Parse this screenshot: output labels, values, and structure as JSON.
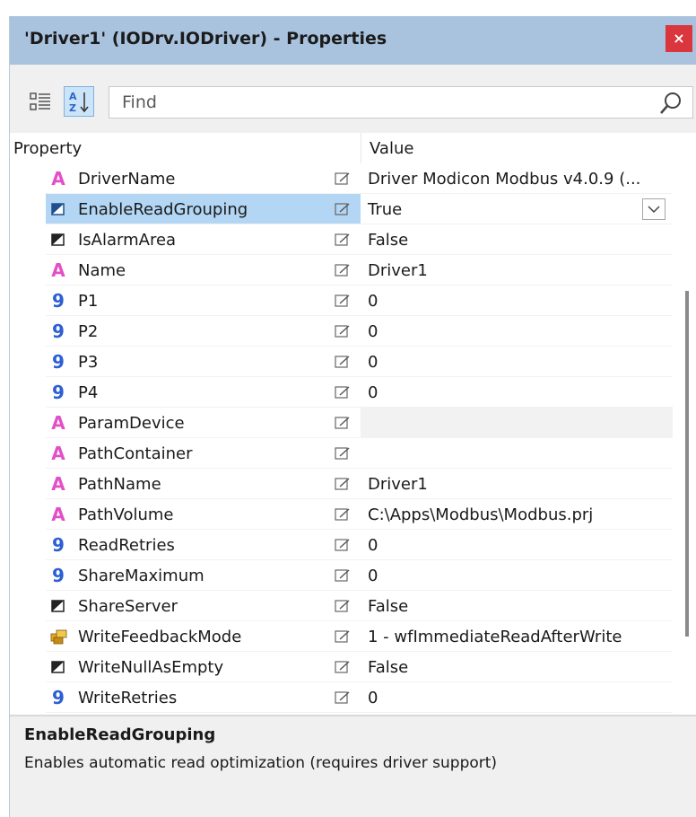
{
  "window": {
    "title": "'Driver1' (IODrv.IODriver) - Properties",
    "close_glyph": "×"
  },
  "toolbar": {
    "categorized_icon": "categorized-view-icon",
    "alphabetical_icon": "sort-alphabetical-icon",
    "find_placeholder": "Find",
    "search_icon": "magnifier-icon"
  },
  "grid": {
    "header_property": "Property",
    "header_value": "Value",
    "rows": [
      {
        "name": "DriverName",
        "type": "text",
        "value": "Driver Modicon Modbus v4.0.9 (..."
      },
      {
        "name": "EnableReadGrouping",
        "type": "bool",
        "value": "True",
        "selected": true,
        "has_dropdown": true
      },
      {
        "name": "IsAlarmArea",
        "type": "bool",
        "value": "False"
      },
      {
        "name": "Name",
        "type": "text",
        "value": "Driver1"
      },
      {
        "name": "P1",
        "type": "number",
        "value": "0"
      },
      {
        "name": "P2",
        "type": "number",
        "value": "0"
      },
      {
        "name": "P3",
        "type": "number",
        "value": "0"
      },
      {
        "name": "P4",
        "type": "number",
        "value": "0"
      },
      {
        "name": "ParamDevice",
        "type": "text",
        "value": "",
        "shaded": true
      },
      {
        "name": "PathContainer",
        "type": "text",
        "value": ""
      },
      {
        "name": "PathName",
        "type": "text",
        "value": "Driver1"
      },
      {
        "name": "PathVolume",
        "type": "text",
        "value": "C:\\Apps\\Modbus\\Modbus.prj"
      },
      {
        "name": "ReadRetries",
        "type": "number",
        "value": "0"
      },
      {
        "name": "ShareMaximum",
        "type": "number",
        "value": "0"
      },
      {
        "name": "ShareServer",
        "type": "bool",
        "value": "False"
      },
      {
        "name": "WriteFeedbackMode",
        "type": "enum",
        "value": "1 - wfImmediateReadAfterWrite"
      },
      {
        "name": "WriteNullAsEmpty",
        "type": "bool",
        "value": "False"
      },
      {
        "name": "WriteRetries",
        "type": "number",
        "value": "0"
      }
    ]
  },
  "description": {
    "title": "EnableReadGrouping",
    "text": "Enables automatic read optimization (requires driver support)"
  },
  "colors": {
    "titlebar": "#a9c3df",
    "close_button": "#d9363e",
    "selection": "#b2d6f4",
    "text_type_icon": "#e34fc7",
    "number_type_icon": "#2d5fd4"
  }
}
